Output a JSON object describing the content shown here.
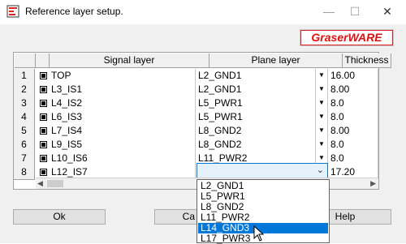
{
  "window": {
    "title": "Reference layer setup.",
    "minimize": "—",
    "maximize": "☐",
    "close": "✕",
    "logo_text": "GraserWARE"
  },
  "grid": {
    "columns": [
      "Signal layer",
      "Plane layer",
      "Thickness"
    ],
    "rows": [
      {
        "num": "1",
        "signal": "TOP",
        "plane": "L2_GND1",
        "thickness": "16.00"
      },
      {
        "num": "2",
        "signal": "L3_IS1",
        "plane": "L2_GND1",
        "thickness": "8.00"
      },
      {
        "num": "3",
        "signal": "L4_IS2",
        "plane": "L5_PWR1",
        "thickness": "8.0"
      },
      {
        "num": "4",
        "signal": "L6_IS3",
        "plane": "L5_PWR1",
        "thickness": "8.0"
      },
      {
        "num": "5",
        "signal": "L7_IS4",
        "plane": "L8_GND2",
        "thickness": "8.00"
      },
      {
        "num": "6",
        "signal": "L9_IS5",
        "plane": "L8_GND2",
        "thickness": "8.0"
      },
      {
        "num": "7",
        "signal": "L10_IS6",
        "plane": "L11_PWR2",
        "thickness": "8.0"
      },
      {
        "num": "8",
        "signal": "L12_IS7",
        "plane": "",
        "thickness": "17.20"
      }
    ]
  },
  "dropdown": {
    "options": [
      "L2_GND1",
      "L5_PWR1",
      "L8_GND2",
      "L11_PWR2",
      "L14_GND3",
      "L17_PWR3"
    ],
    "selected_index": 4
  },
  "buttons": {
    "ok": "Ok",
    "cancel": "Ca",
    "help": "Help"
  }
}
